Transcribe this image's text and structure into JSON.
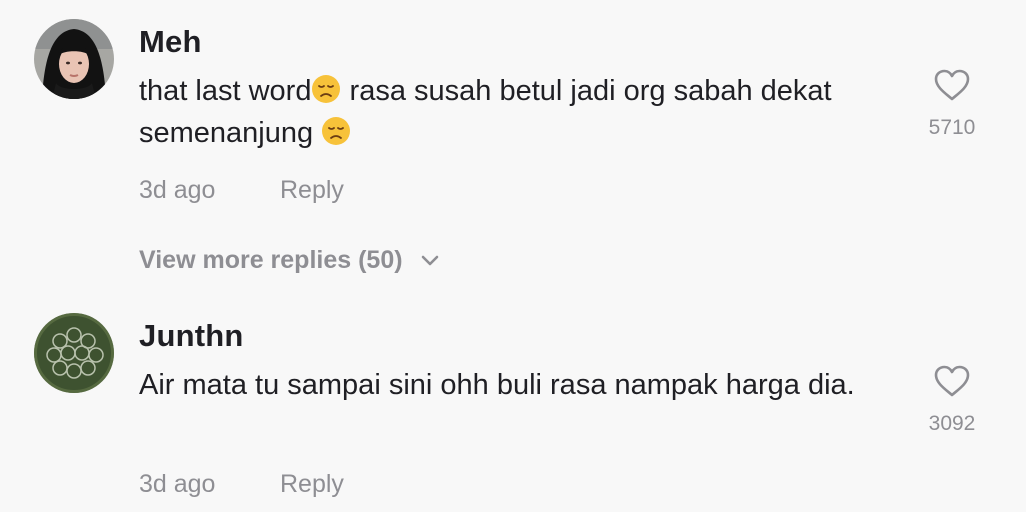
{
  "comments": [
    {
      "username": "Meh",
      "text_part1": "that last word",
      "emoji1": "disappointed-face-emoji",
      "text_part2": " rasa susah betul jadi org sabah dekat semenanjung ",
      "emoji2": "disappointed-face-emoji",
      "time": "3d ago",
      "reply": "Reply",
      "likes": "5710",
      "like_icon": "heart-outline-icon"
    },
    {
      "username": "Junthn",
      "text": "Air mata tu sampai sini ohh buli rasa nampak harga dia.",
      "time": "3d ago",
      "reply": "Reply",
      "likes": "3092",
      "like_icon": "heart-outline-icon"
    }
  ],
  "view_more": {
    "label": "View more replies (50)",
    "icon": "chevron-down-icon"
  },
  "colors": {
    "background": "#f8f8f8",
    "primary_text": "#1f1f24",
    "secondary_text": "#8e8e93"
  }
}
